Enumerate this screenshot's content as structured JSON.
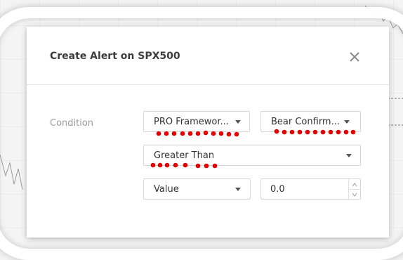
{
  "dialog": {
    "title": "Create Alert on SPX500",
    "close_icon": "close-icon"
  },
  "condition": {
    "label": "Condition",
    "indicator_select": {
      "value": "PRO Framewor..."
    },
    "plot_select": {
      "value": "Bear Confirm..."
    },
    "operator_select": {
      "value": "Greater Than"
    },
    "value_type_select": {
      "value": "Value"
    },
    "value_input": {
      "value": "0.0"
    }
  },
  "colors": {
    "annotation_dots": "#e60000",
    "title_text": "#3c3c3c",
    "label_text": "#9a9a9a",
    "border": "#d6d6d6"
  }
}
